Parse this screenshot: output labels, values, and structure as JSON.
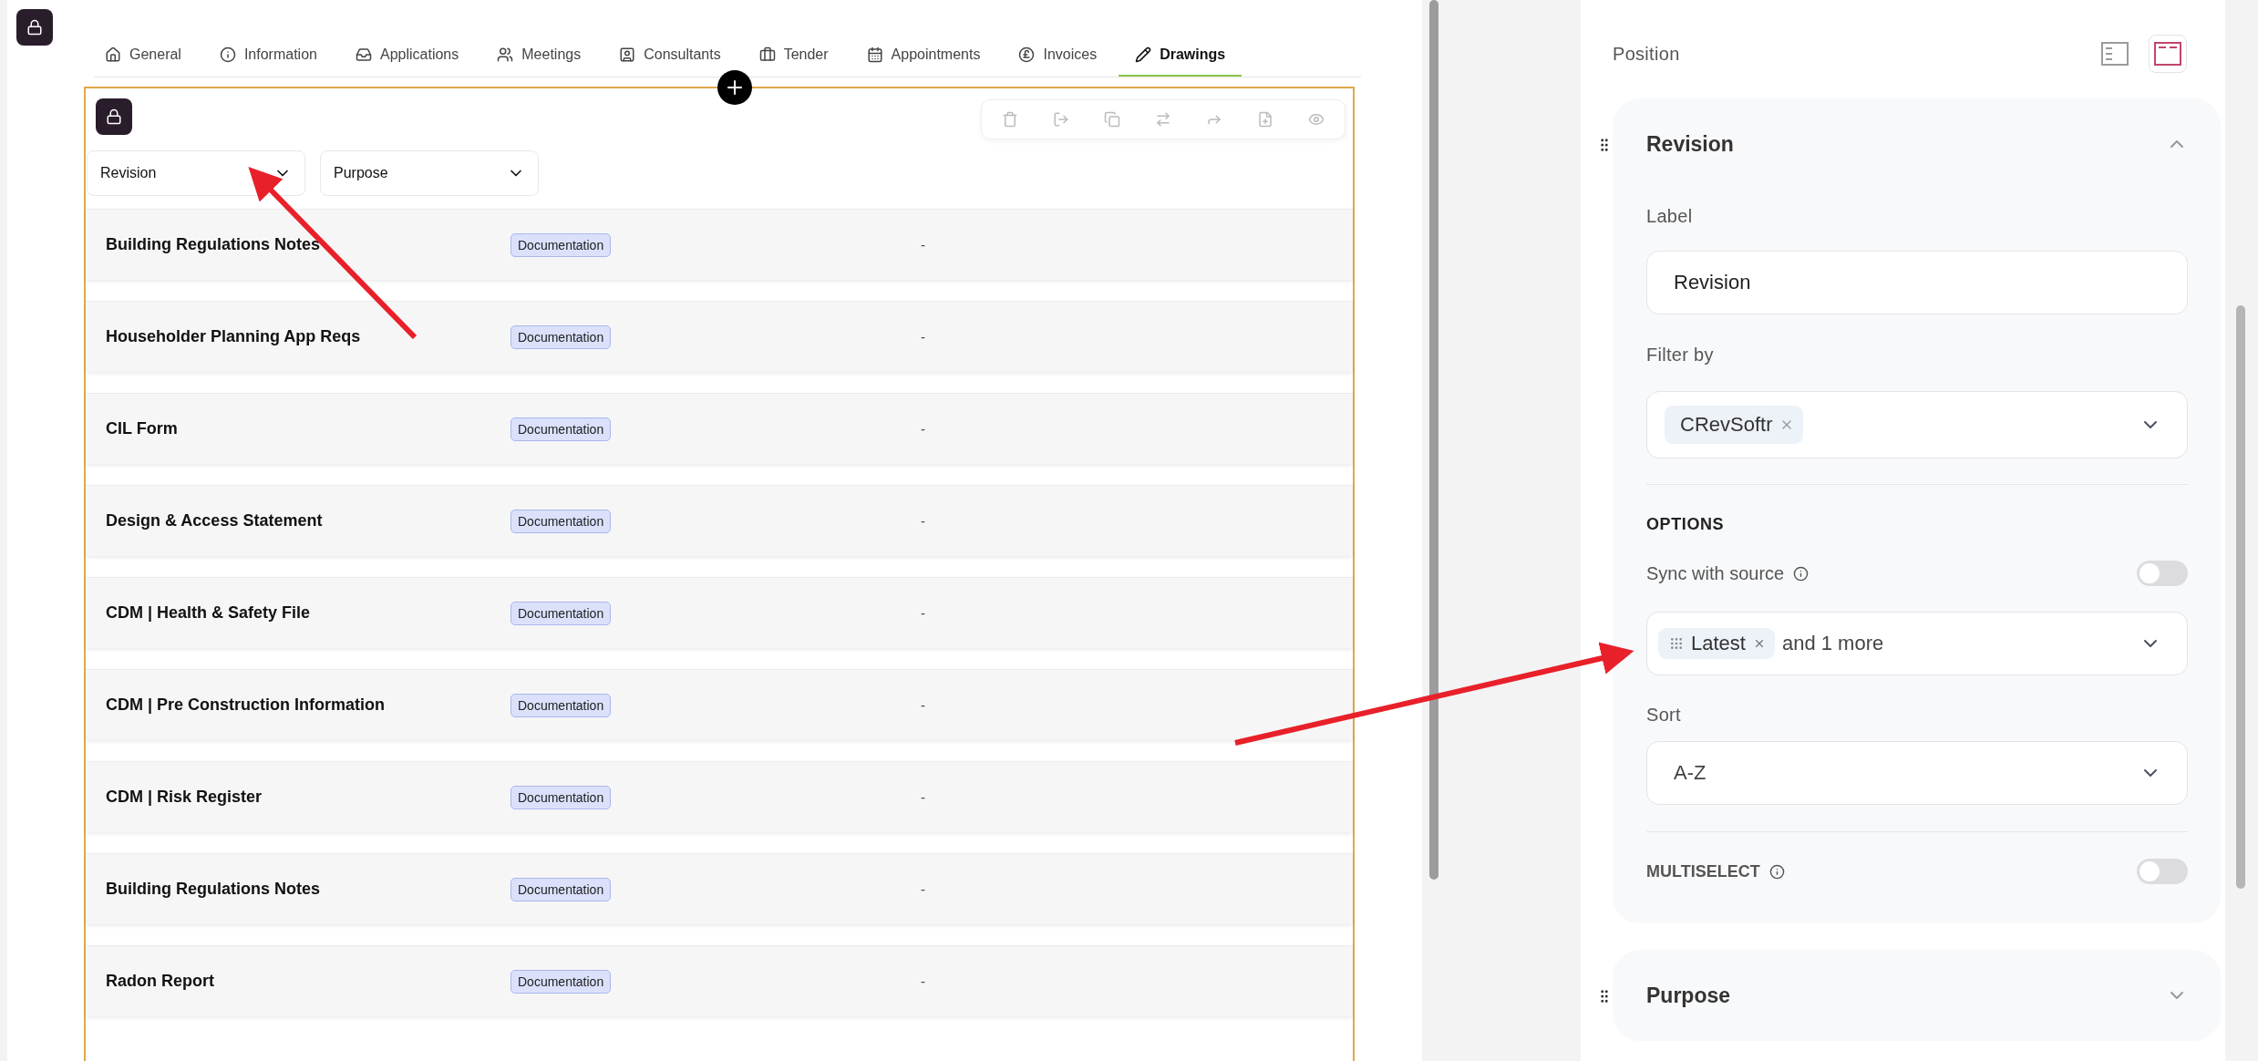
{
  "tabs": [
    {
      "label": "General",
      "selected": false
    },
    {
      "label": "Information",
      "selected": false
    },
    {
      "label": "Applications",
      "selected": false
    },
    {
      "label": "Meetings",
      "selected": false
    },
    {
      "label": "Consultants",
      "selected": false
    },
    {
      "label": "Tender",
      "selected": false
    },
    {
      "label": "Appointments",
      "selected": false
    },
    {
      "label": "Invoices",
      "selected": false
    },
    {
      "label": "Drawings",
      "selected": true
    }
  ],
  "filters": [
    {
      "label": "Revision"
    },
    {
      "label": "Purpose"
    }
  ],
  "rows": [
    {
      "name": "Building Regulations Notes",
      "tag": "Documentation",
      "value": "-"
    },
    {
      "name": "Householder Planning App Reqs",
      "tag": "Documentation",
      "value": "-"
    },
    {
      "name": "CIL Form",
      "tag": "Documentation",
      "value": "-"
    },
    {
      "name": "Design & Access Statement",
      "tag": "Documentation",
      "value": "-"
    },
    {
      "name": "CDM | Health & Safety File",
      "tag": "Documentation",
      "value": "-"
    },
    {
      "name": "CDM | Pre Construction Information",
      "tag": "Documentation",
      "value": "-"
    },
    {
      "name": "CDM | Risk Register",
      "tag": "Documentation",
      "value": "-"
    },
    {
      "name": "Building Regulations Notes",
      "tag": "Documentation",
      "value": "-"
    },
    {
      "name": "Radon Report",
      "tag": "Documentation",
      "value": "-"
    }
  ],
  "settings": {
    "position_label": "Position",
    "position_options": [
      {
        "selected": false
      },
      {
        "selected": true
      }
    ],
    "sections": [
      {
        "title": "Revision",
        "expanded": true,
        "label_label": "Label",
        "label_value": "Revision",
        "filter_label": "Filter by",
        "filter_chips": [
          "CRevSoftr"
        ],
        "options_heading": "OPTIONS",
        "sync_label": "Sync with source",
        "sync_on": false,
        "sync_chip": "Latest",
        "sync_more": "and 1 more",
        "sort_label": "Sort",
        "sort_value": "A-Z",
        "multiselect_label": "MULTISELECT",
        "multiselect_on": false
      },
      {
        "title": "Purpose",
        "expanded": false
      }
    ]
  }
}
